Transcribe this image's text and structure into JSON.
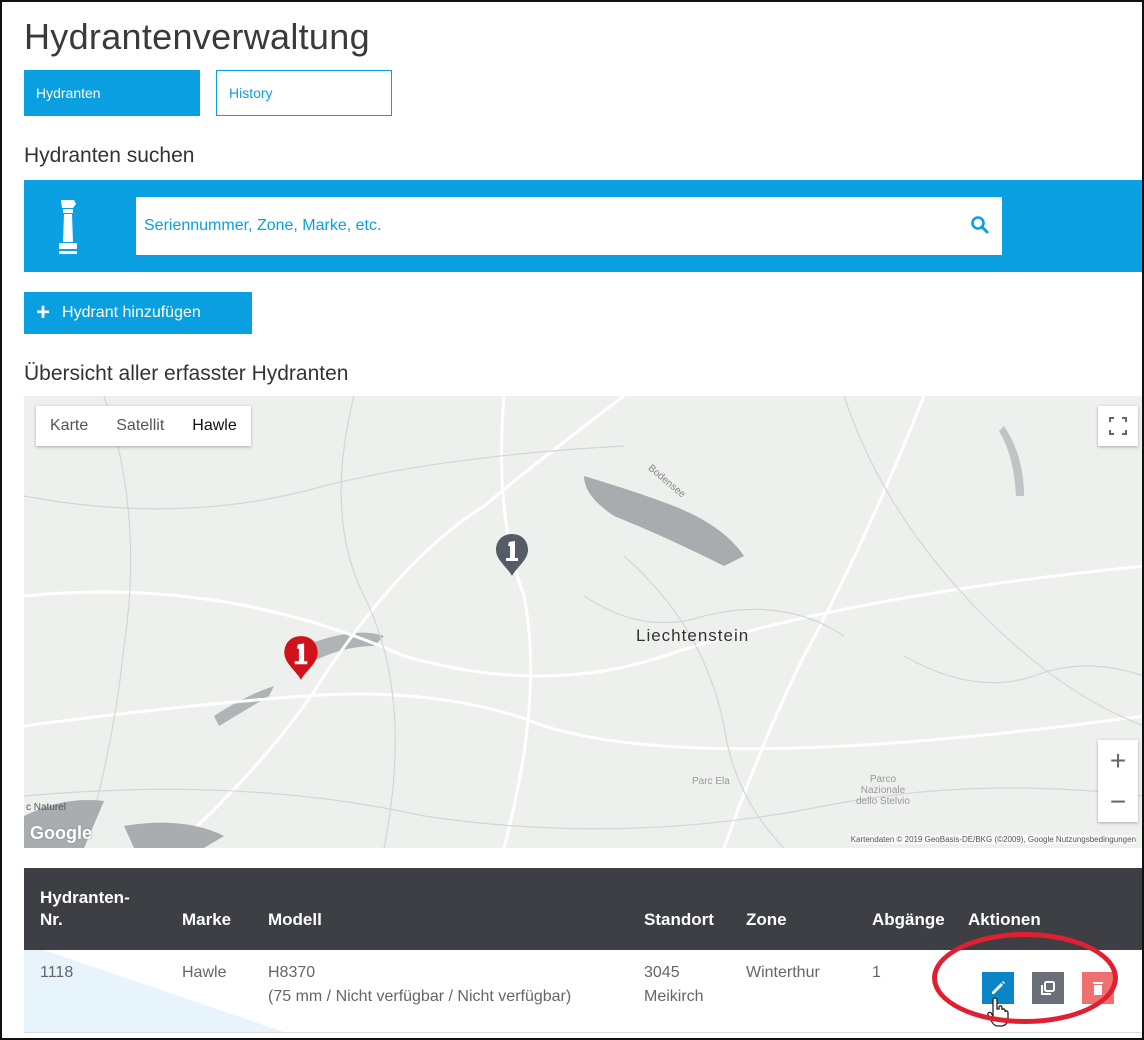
{
  "app": {
    "title": "Hydrantenverwaltung"
  },
  "tabs": [
    {
      "label": "Hydranten",
      "active": true
    },
    {
      "label": "History",
      "active": false
    }
  ],
  "search": {
    "heading": "Hydranten suchen",
    "placeholder": "Seriennummer, Zone, Marke, etc.",
    "icon": "search-icon",
    "leading_icon": "hydrant-icon"
  },
  "add_button": {
    "label": "Hydrant hinzufügen",
    "icon": "plus-icon"
  },
  "overview": {
    "heading": "Übersicht aller erfasster Hydranten"
  },
  "map": {
    "type_buttons": [
      "Karte",
      "Satellit",
      "Hawle"
    ],
    "selected_type": "Hawle",
    "labels": {
      "country": "Liechtenstein",
      "parc_ela": "Parc Ela",
      "parco": "Parco\nNazionale\ndello Stelvio",
      "naturel": "c Naturel",
      "lake": "Bodensee"
    },
    "logo": "Google",
    "attribution": "Kartendaten © 2019 GeoBasis-DE/BKG (©2009), Google    Nutzungsbedingungen",
    "zoom_in": "+",
    "zoom_out": "−",
    "markers": [
      {
        "color": "#d0121b",
        "label": "1"
      },
      {
        "color": "#555c66",
        "label": "1"
      }
    ],
    "colors": {
      "accent": "#0a9fe0",
      "marker_red": "#d0121b",
      "marker_gray": "#555c66"
    }
  },
  "table": {
    "headers": {
      "nr_line1": "Hydranten-",
      "nr_line2": "Nr.",
      "marke": "Marke",
      "modell": "Modell",
      "standort": "Standort",
      "zone": "Zone",
      "abgaenge": "Abgänge",
      "aktionen": "Aktionen"
    },
    "rows": [
      {
        "nr": "1118",
        "marke": "Hawle",
        "modell_line1": "H8370",
        "modell_line2": "(75 mm / Nicht verfügbar / Nicht verfügbar)",
        "standort_line1": "3045",
        "standort_line2": "Meikirch",
        "zone": "Winterthur",
        "abgaenge": "1"
      }
    ],
    "action_colors": {
      "edit": "#0a85c7",
      "copy": "#6b7078",
      "delete": "#f07070"
    }
  }
}
